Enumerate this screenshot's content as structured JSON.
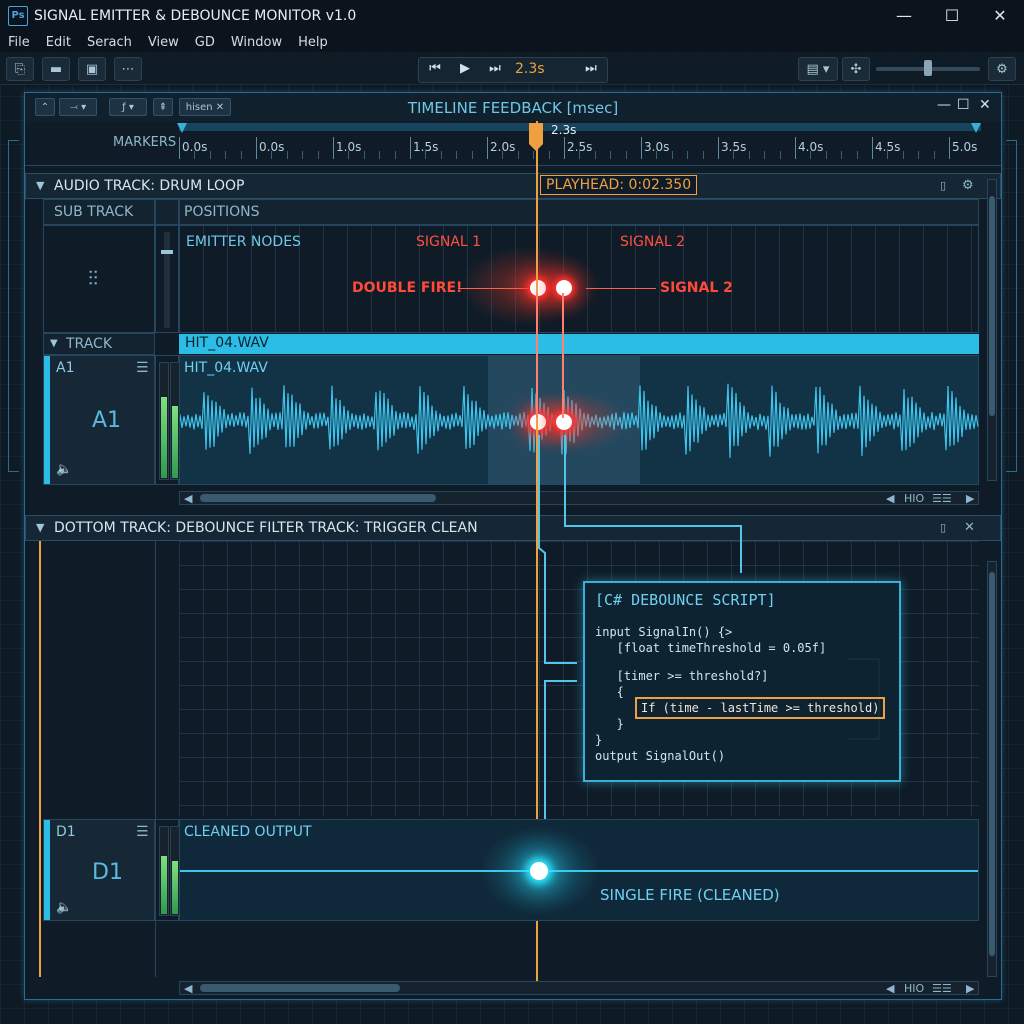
{
  "app": {
    "icon_text": "Ps",
    "title": "SIGNAL EMITTER & DEBOUNCE MONITOR v1.0",
    "window_controls": {
      "minimize": "—",
      "maximize": "☐",
      "close": "✕"
    }
  },
  "menu": {
    "items": [
      "File",
      "Edit",
      "Serach",
      "View",
      "GD",
      "Window",
      "Help"
    ]
  },
  "toolbar": {
    "transport_time": "2.3s",
    "icons": [
      "new-file-icon",
      "open-folder-icon",
      "save-icon",
      "grid-options-icon",
      "view-options-icon",
      "snap-icon",
      "settings-gear-icon"
    ]
  },
  "panel": {
    "title": "TIMELINE FEEDBACK [msec]",
    "tool_labels": {
      "mode": "hisen"
    },
    "controls": {
      "minimize": "—",
      "maximize": "☐",
      "close": "✕"
    }
  },
  "ruler": {
    "label": "MARKERS",
    "playhead_time": "2.3s",
    "ticks": [
      "0.0s",
      "0.0s",
      "1.0s",
      "1.5s",
      "2.0s",
      "2.5s",
      "3.0s",
      "3.5s",
      "4.0s",
      "4.5s",
      "5.0s"
    ]
  },
  "audio_section": {
    "title": "AUDIO TRACK: DRUM LOOP",
    "playhead_readout": "PLAYHEAD: 0:02.350",
    "col_sub_track": "SUB TRACK",
    "col_positions": "POSITIONS",
    "emitter_nodes_label": "EMITTER NODES",
    "signal1": "SIGNAL 1",
    "signal2_top": "SIGNAL 2",
    "double_fire": "DOUBLE FIRE!",
    "signal2_side": "SIGNAL 2",
    "track_header": "TRACK",
    "clip_header": "HIT_04.WAV",
    "channel_short": "A1",
    "channel_name": "A1",
    "clip_name": "HIT_04.WAV",
    "timecode": "HIO"
  },
  "debounce_section": {
    "title": "DOTTOM TRACK: DEBOUNCE FILTER TRACK: TRIGGER CLEAN",
    "script_title": "[C# DEBOUNCE SCRIPT]",
    "code_lines": [
      "input SignalIn() {>",
      "   [float timeThreshold = 0.05f]",
      "   [timer >= threshold?]",
      "   {",
      "   }",
      "}",
      "output SignalOut()"
    ],
    "highlight_line": "If (time - lastTime >= threshold)",
    "channel_short": "D1",
    "channel_name": "D1",
    "clip_name": "CLEANED OUTPUT",
    "single_fire": "SINGLE FIRE (CLEANED)",
    "timecode": "HIO"
  },
  "colors": {
    "accent": "#3ab0d8",
    "playhead": "#f0a040",
    "alert": "#ff3a30",
    "clean": "#30e8ff"
  }
}
